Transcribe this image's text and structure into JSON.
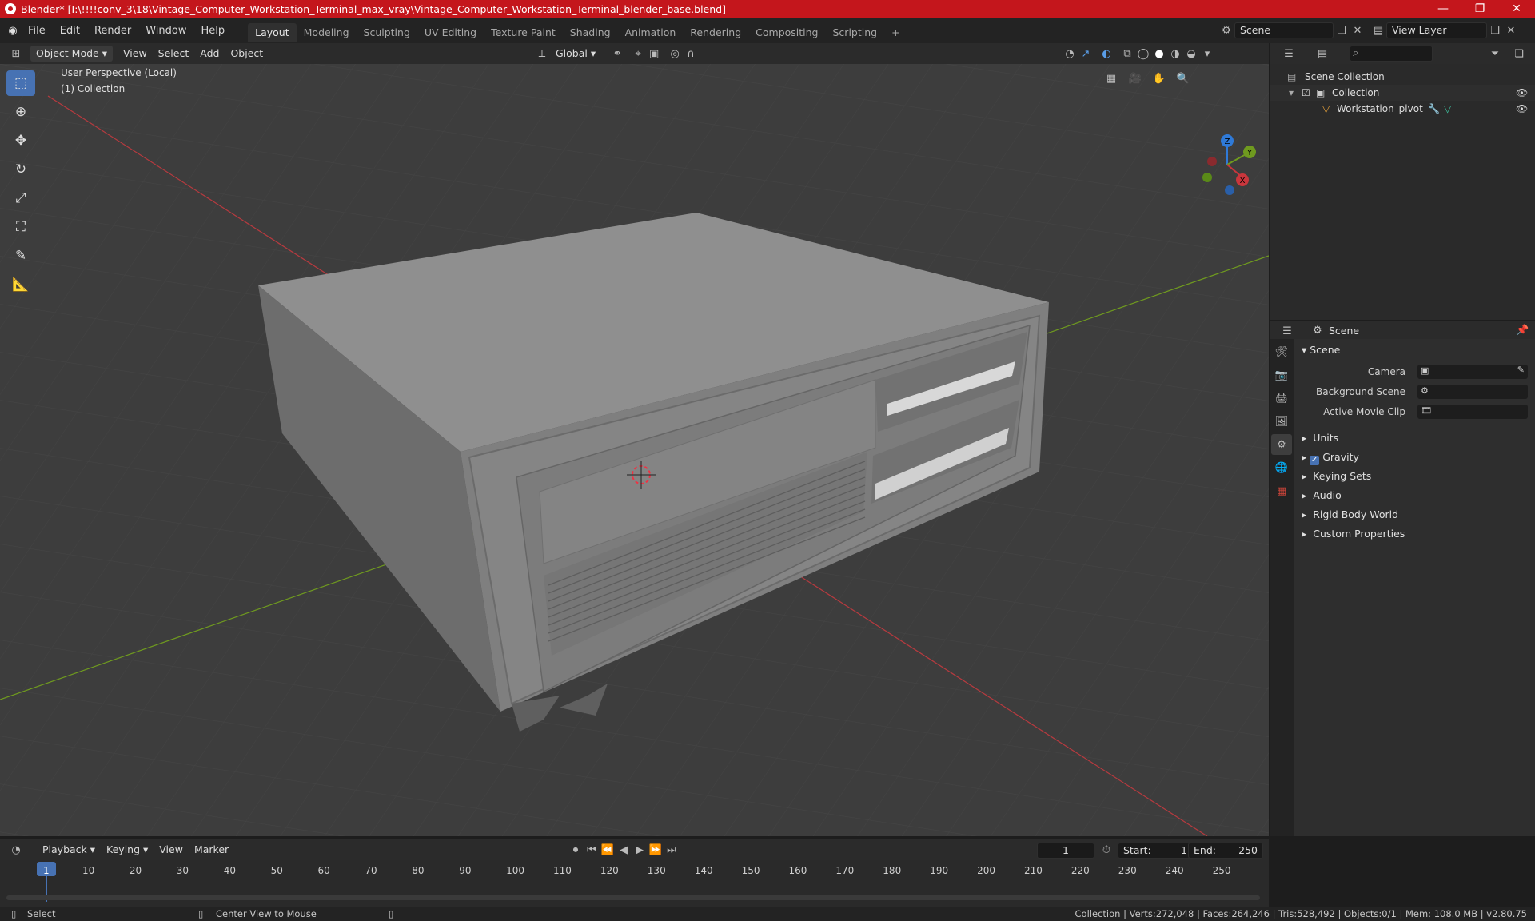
{
  "window": {
    "title": "Blender* [I:\\!!!!conv_3\\18\\Vintage_Computer_Workstation_Terminal_max_vray\\Vintage_Computer_Workstation_Terminal_blender_base.blend]",
    "controls": [
      "—",
      "❐",
      "✕"
    ]
  },
  "menus": [
    "File",
    "Edit",
    "Render",
    "Window",
    "Help"
  ],
  "workspaces": [
    "Layout",
    "Modeling",
    "Sculpting",
    "UV Editing",
    "Texture Paint",
    "Shading",
    "Animation",
    "Rendering",
    "Compositing",
    "Scripting",
    "+"
  ],
  "scene_field": "Scene",
  "view_layer_field": "View Layer",
  "viewport_header": {
    "mode": "Object Mode",
    "menus": [
      "View",
      "Select",
      "Add",
      "Object"
    ],
    "orientation": "Global"
  },
  "viewport": {
    "perspective_label": "User Perspective (Local)",
    "collection_label": "(1) Collection",
    "gizmo": {
      "z": "Z",
      "y": "Y",
      "x": "X"
    }
  },
  "outliner": {
    "rows": [
      "Scene Collection",
      "Collection",
      "Workstation_pivot"
    ]
  },
  "properties": {
    "header": "Scene",
    "section": "Scene",
    "fields": [
      {
        "label": "Camera"
      },
      {
        "label": "Background Scene"
      },
      {
        "label": "Active Movie Clip"
      }
    ],
    "panels": [
      "Units",
      "Gravity",
      "Keying Sets",
      "Audio",
      "Rigid Body World",
      "Custom Properties"
    ]
  },
  "timeline": {
    "menus": [
      "Playback",
      "Keying",
      "View",
      "Marker"
    ],
    "current_frame": "1",
    "start_label": "Start:",
    "start": "1",
    "end_label": "End:",
    "end": "250",
    "ticks": [
      "1",
      "10",
      "20",
      "30",
      "40",
      "50",
      "60",
      "70",
      "80",
      "90",
      "100",
      "110",
      "120",
      "130",
      "140",
      "150",
      "160",
      "170",
      "180",
      "190",
      "200",
      "210",
      "220",
      "230",
      "240",
      "250"
    ]
  },
  "statusbar": {
    "left": "Select",
    "middle": "Center View to Mouse",
    "right": "Collection | Verts:272,048 | Faces:264,246 | Tris:528,492 | Objects:0/1 | Mem: 108.0 MB | v2.80.75"
  },
  "colors": {
    "titlebar": "#c4161c",
    "accent": "#4772b3",
    "x_axis": "#c9363c",
    "y_axis": "#6f9a1f",
    "z_axis": "#2f7ad8"
  }
}
